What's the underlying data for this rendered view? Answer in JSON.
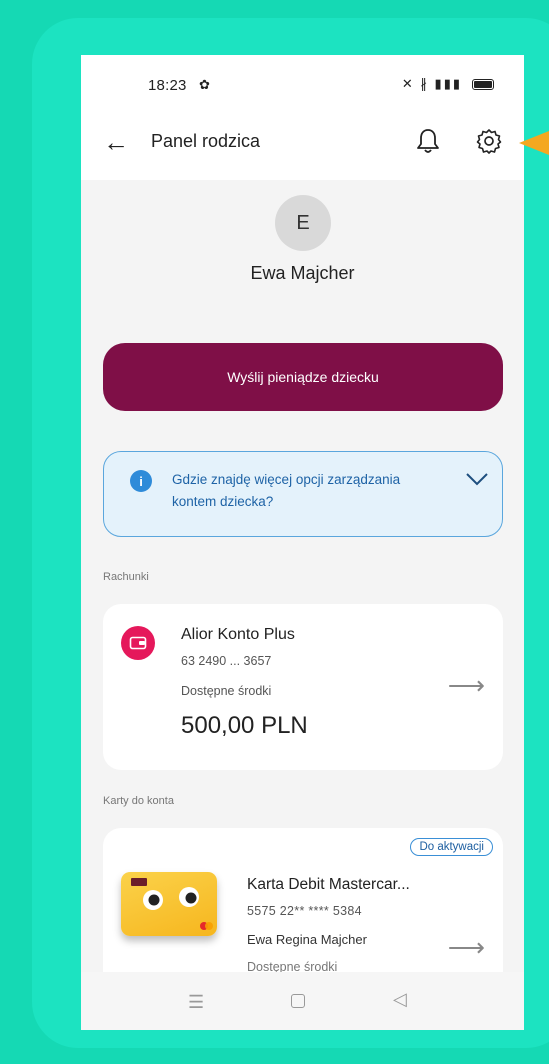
{
  "status_bar": {
    "time": "18:23"
  },
  "app_bar": {
    "title": "Panel rodzica",
    "back_icon": "back-arrow-icon",
    "bell_icon": "bell-icon",
    "settings_icon": "gear-icon"
  },
  "profile": {
    "initial": "E",
    "name": "Ewa Majcher"
  },
  "actions": {
    "send_money_label": "Wyślij pieniądze dziecku"
  },
  "info_box": {
    "text": "Gdzie znajdę więcej opcji zarządzania kontem dziecka?"
  },
  "accounts_section": {
    "heading": "Rachunki",
    "account": {
      "name": "Alior Konto Plus",
      "number": "63 2490 ... 3657",
      "available_label": "Dostępne środki",
      "balance": "500,00 PLN"
    }
  },
  "cards_section": {
    "heading": "Karty do konta",
    "card": {
      "badge": "Do aktywacji",
      "name": "Karta Debit Mastercar...",
      "number": "5575 22** **** 5384",
      "owner": "Ewa Regina Majcher",
      "available_label": "Dostępne środki"
    }
  },
  "colors": {
    "background": "#15d9b4",
    "primary_button": "#7f0f47",
    "info_border": "#5aa6dd",
    "account_icon": "#e5185b",
    "card": "#f6b61e"
  }
}
